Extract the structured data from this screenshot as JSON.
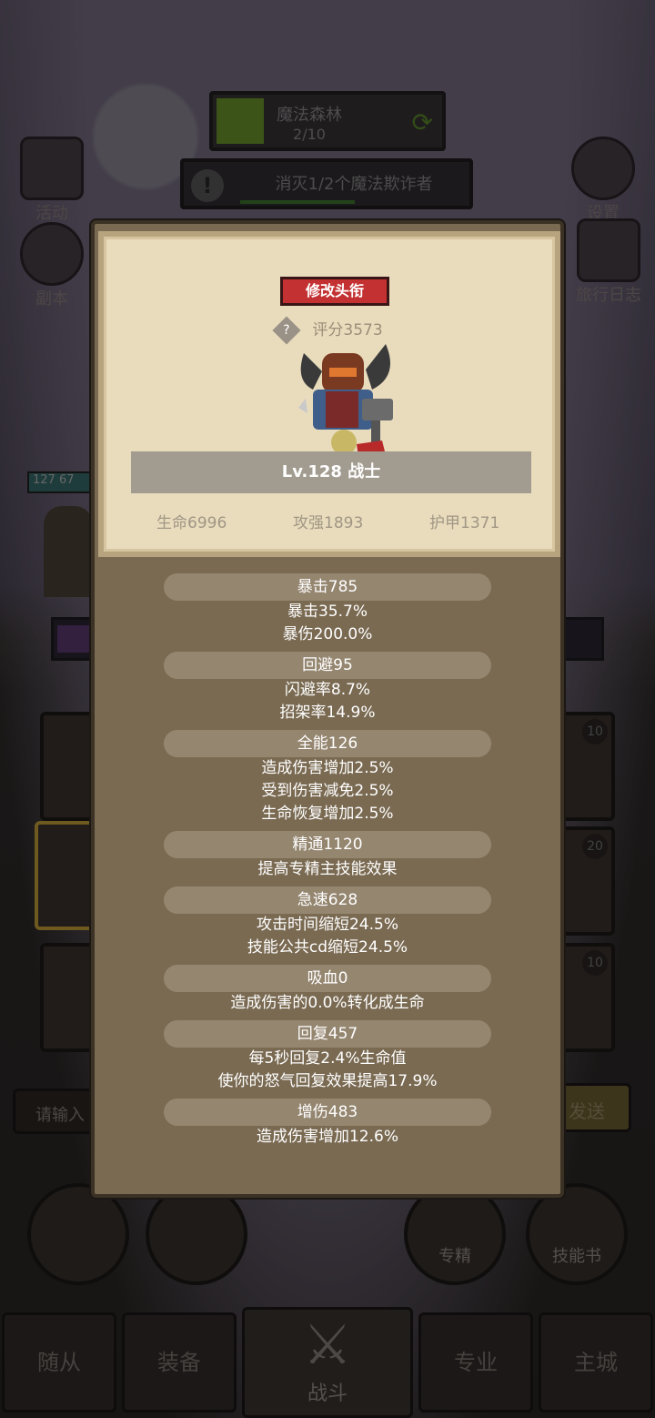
{
  "top": {
    "stage_name": "魔法森林",
    "stage_progress": "2/10",
    "quest_text": "消灭1/2个魔法欺诈者"
  },
  "side": {
    "activity": "活动",
    "dungeon": "副本",
    "settings": "设置",
    "journal": "旅行日志"
  },
  "background": {
    "hp_level": "127",
    "hp_value": "67",
    "slot_counts": [
      "10",
      "20",
      "10"
    ],
    "input_placeholder": "请输入",
    "send_label": "发送",
    "specialize": "专精",
    "skillbook": "技能书"
  },
  "nav": {
    "followers": "随从",
    "equipment": "装备",
    "battle": "战斗",
    "profession": "专业",
    "main_city": "主城"
  },
  "profile": {
    "edit_title_button": "修改头衔",
    "score": "评分3573",
    "level_class": "Lv.128 战士",
    "hp": "生命6996",
    "attack": "攻强1893",
    "armor": "护甲1371"
  },
  "stats": [
    {
      "title": "暴击785",
      "lines": [
        "暴击35.7%",
        "暴伤200.0%"
      ]
    },
    {
      "title": "回避95",
      "lines": [
        "闪避率8.7%",
        "招架率14.9%"
      ]
    },
    {
      "title": "全能126",
      "lines": [
        "造成伤害增加2.5%",
        "受到伤害减免2.5%",
        "生命恢复增加2.5%"
      ]
    },
    {
      "title": "精通1120",
      "lines": [
        "提高专精主技能效果"
      ]
    },
    {
      "title": "急速628",
      "lines": [
        "攻击时间缩短24.5%",
        "技能公共cd缩短24.5%"
      ]
    },
    {
      "title": "吸血0",
      "lines": [
        "造成伤害的0.0%转化成生命"
      ]
    },
    {
      "title": "回复457",
      "lines": [
        "每5秒回复2.4%生命值",
        "使你的怒气回复效果提高17.9%"
      ]
    },
    {
      "title": "增伤483",
      "lines": [
        "造成伤害增加12.6%"
      ]
    }
  ]
}
